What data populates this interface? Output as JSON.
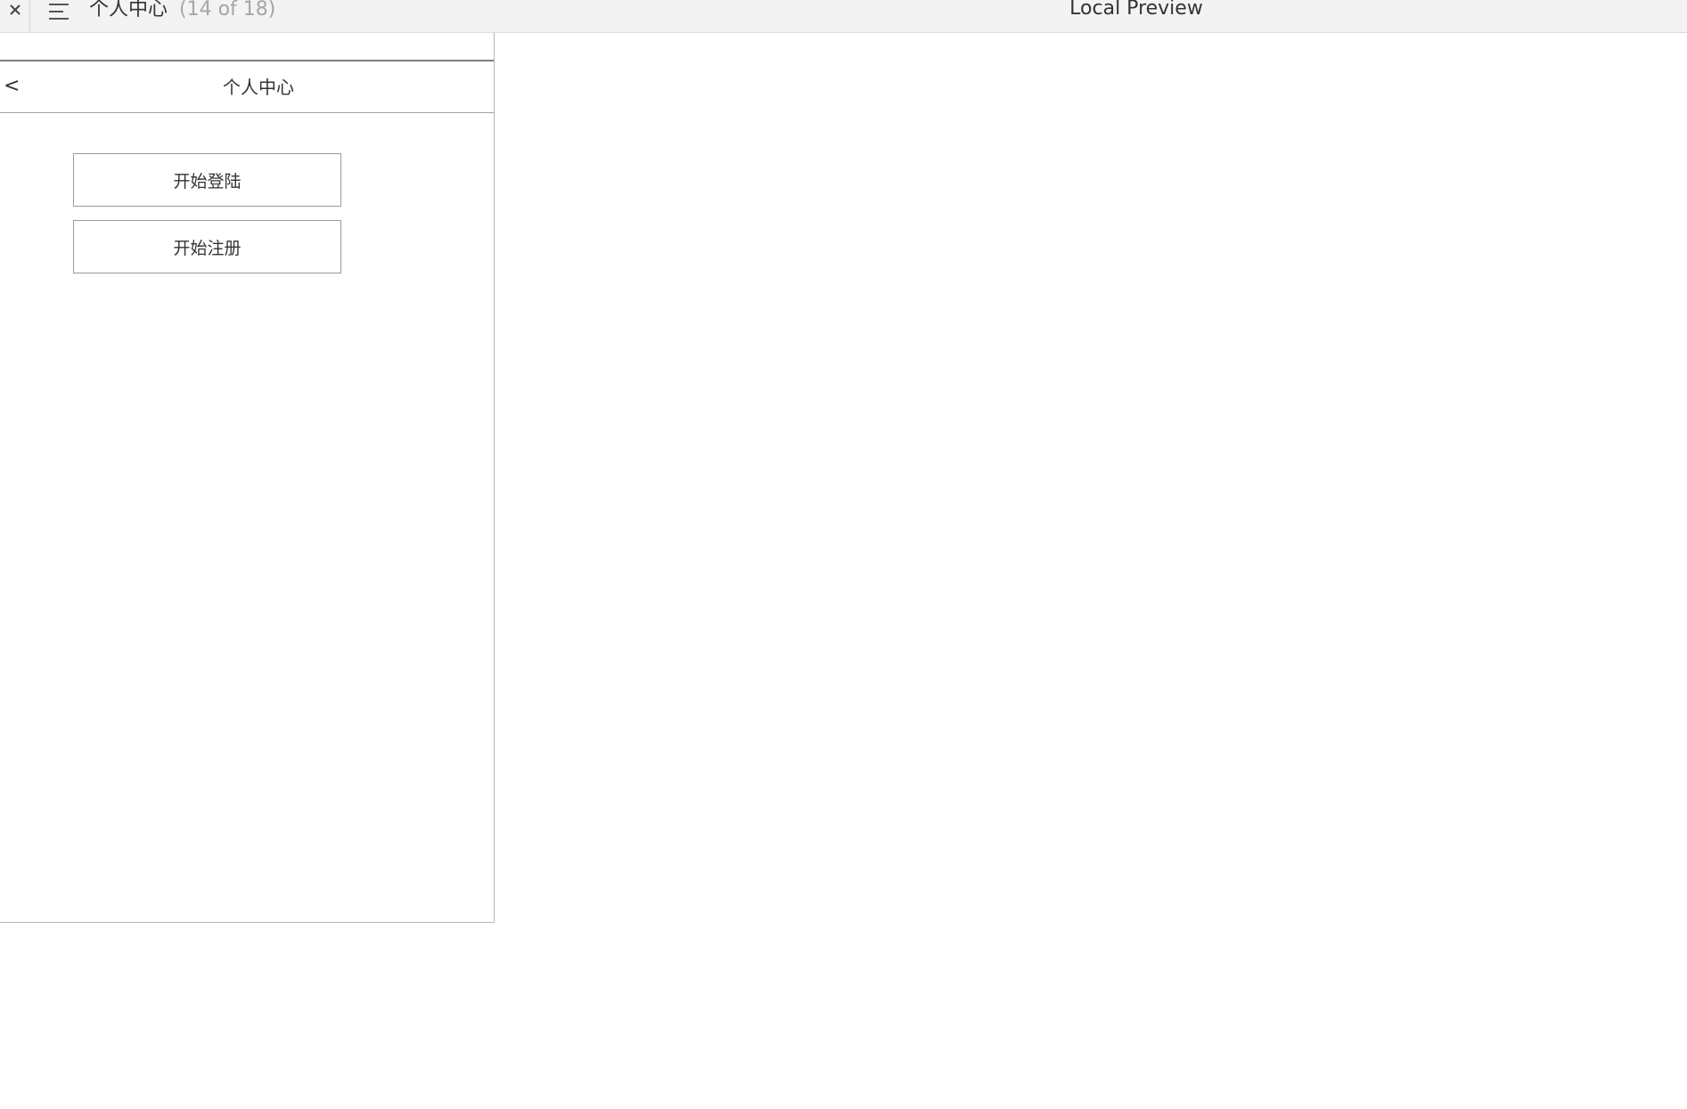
{
  "topbar": {
    "page_name": "个人中心",
    "page_count": "(14 of 18)",
    "app_title": "Local Preview",
    "close_icon": "close-icon",
    "menu_icon": "menu-icon"
  },
  "screen": {
    "back_label": "<",
    "title": "个人中心",
    "buttons": [
      {
        "label": "开始登陆"
      },
      {
        "label": "开始注册"
      }
    ]
  },
  "colors": {
    "topbar_bg": "#f3f3f3",
    "text": "#333333",
    "muted_text": "#a6a6a6",
    "border": "#9a9a9a"
  }
}
